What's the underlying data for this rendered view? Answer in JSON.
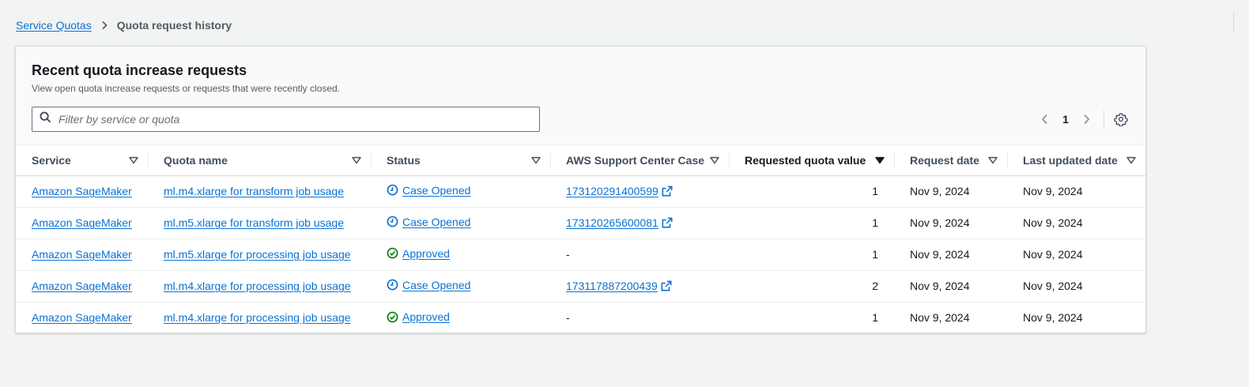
{
  "breadcrumb": {
    "root": "Service Quotas",
    "current": "Quota request history"
  },
  "panel": {
    "title": "Recent quota increase requests",
    "description": "View open quota increase requests or requests that were recently closed."
  },
  "search": {
    "placeholder": "Filter by service or quota",
    "value": ""
  },
  "pagination": {
    "current_page": "1"
  },
  "columns": {
    "service": "Service",
    "quota_name": "Quota name",
    "status": "Status",
    "case": "AWS Support Center Case",
    "requested_value": "Requested quota value",
    "request_date": "Request date",
    "last_updated": "Last updated date"
  },
  "rows": [
    {
      "service": "Amazon SageMaker",
      "quota": "ml.m4.xlarge for transform job usage",
      "status": "Case Opened",
      "status_icon": "clock-icon",
      "case": "17312029140059​9",
      "value": "1",
      "request_date": "Nov 9, 2024",
      "updated": "Nov 9, 2024"
    },
    {
      "service": "Amazon SageMaker",
      "quota": "ml.m5.xlarge for transform job usage",
      "status": "Case Opened",
      "status_icon": "clock-icon",
      "case": "17312026560008​1",
      "value": "1",
      "request_date": "Nov 9, 2024",
      "updated": "Nov 9, 2024"
    },
    {
      "service": "Amazon SageMaker",
      "quota": "ml.m5.xlarge for processing job usage",
      "status": "Approved",
      "status_icon": "check-circle-icon",
      "case": "-",
      "value": "1",
      "request_date": "Nov 9, 2024",
      "updated": "Nov 9, 2024"
    },
    {
      "service": "Amazon SageMaker",
      "quota": "ml.m4.xlarge for processing job usage",
      "status": "Case Opened",
      "status_icon": "clock-icon",
      "case": "17311788720043​9",
      "value": "2",
      "request_date": "Nov 9, 2024",
      "updated": "Nov 9, 2024"
    },
    {
      "service": "Amazon SageMaker",
      "quota": "ml.m4.xlarge for processing job usage",
      "status": "Approved",
      "status_icon": "check-circle-icon",
      "case": "-",
      "value": "1",
      "request_date": "Nov 9, 2024",
      "updated": "Nov 9, 2024"
    }
  ],
  "colors": {
    "link": "#0972d3",
    "pending": "#0972d3",
    "success": "#037f0c",
    "text": "#16191f"
  }
}
